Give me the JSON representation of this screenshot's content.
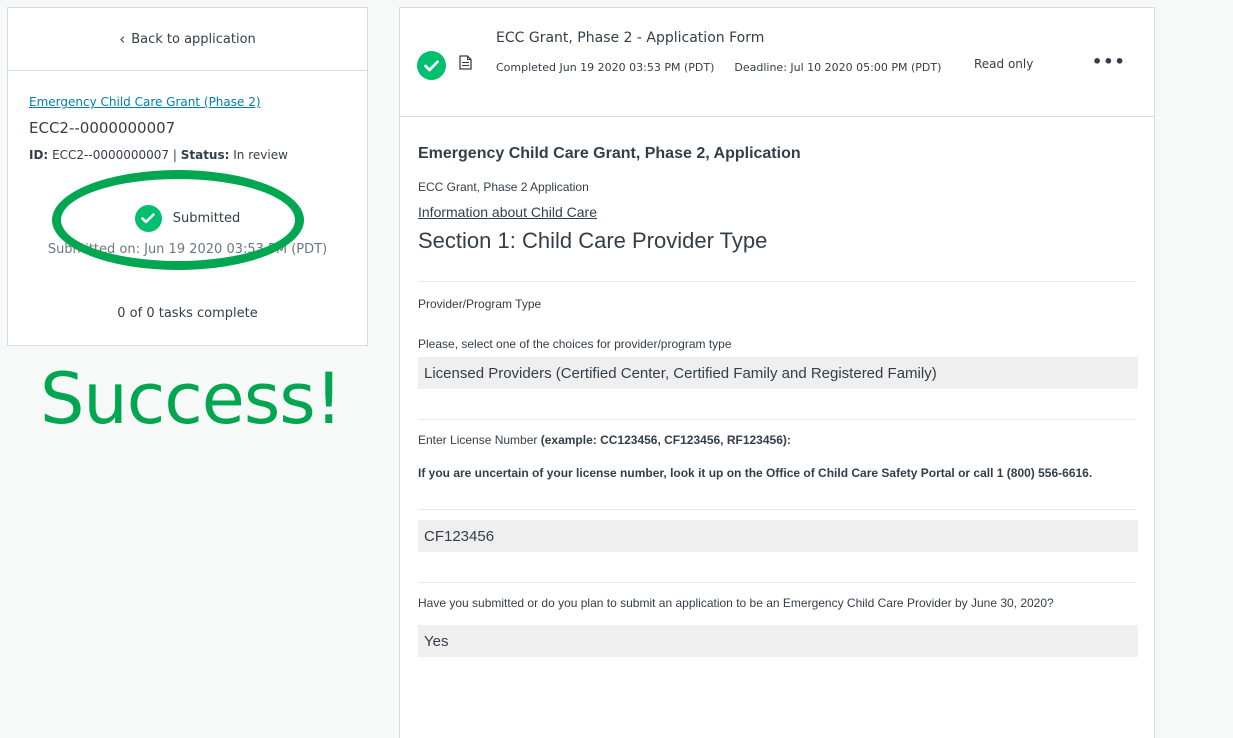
{
  "left": {
    "back_label": "Back to application",
    "grant_link": "Emergency Child Care Grant (Phase 2)",
    "app_number": "ECC2--0000000007",
    "id_label": "ID:",
    "id_value": "ECC2--0000000007",
    "status_label": "Status:",
    "status_value": "In review",
    "submitted_label": "Submitted",
    "submitted_on": "Submitted on: Jun 19 2020 03:53 PM (PDT)",
    "tasks": "0 of 0 tasks complete",
    "annotation": "Success!"
  },
  "header": {
    "title": "ECC Grant, Phase 2 - Application Form",
    "completed": "Completed Jun 19 2020 03:53 PM (PDT)",
    "deadline": "Deadline: Jul 10 2020 05:00 PM (PDT)",
    "read_only": "Read only",
    "more_label": "•••"
  },
  "form": {
    "title": "Emergency Child Care Grant, Phase 2, Application",
    "subtitle": "ECC Grant, Phase 2 Application",
    "info_link": "Information about Child Care",
    "section_title": "Section 1: Child Care Provider Type",
    "provider_type_label": "Provider/Program Type",
    "provider_select_q": "Please, select one of the choices for provider/program type",
    "provider_answer": "Licensed Providers (Certified Center, Certified Family and Registered Family)",
    "license_q": "Enter License Number",
    "license_example": "(example: CC123456, CF123456, RF123456):",
    "license_help": "If you are uncertain of your license number, look it up on the Office of Child Care Safety Portal or call 1 (800) 556-6616.",
    "license_answer": "CF123456",
    "ecc_q": "Have you submitted or do you plan to submit an application to be an Emergency Child Care Provider by June 30, 2020?",
    "ecc_answer": "Yes"
  },
  "colors": {
    "success_green": "#00bf6f",
    "annotation_green": "#00a650",
    "link_blue": "#007faa"
  }
}
